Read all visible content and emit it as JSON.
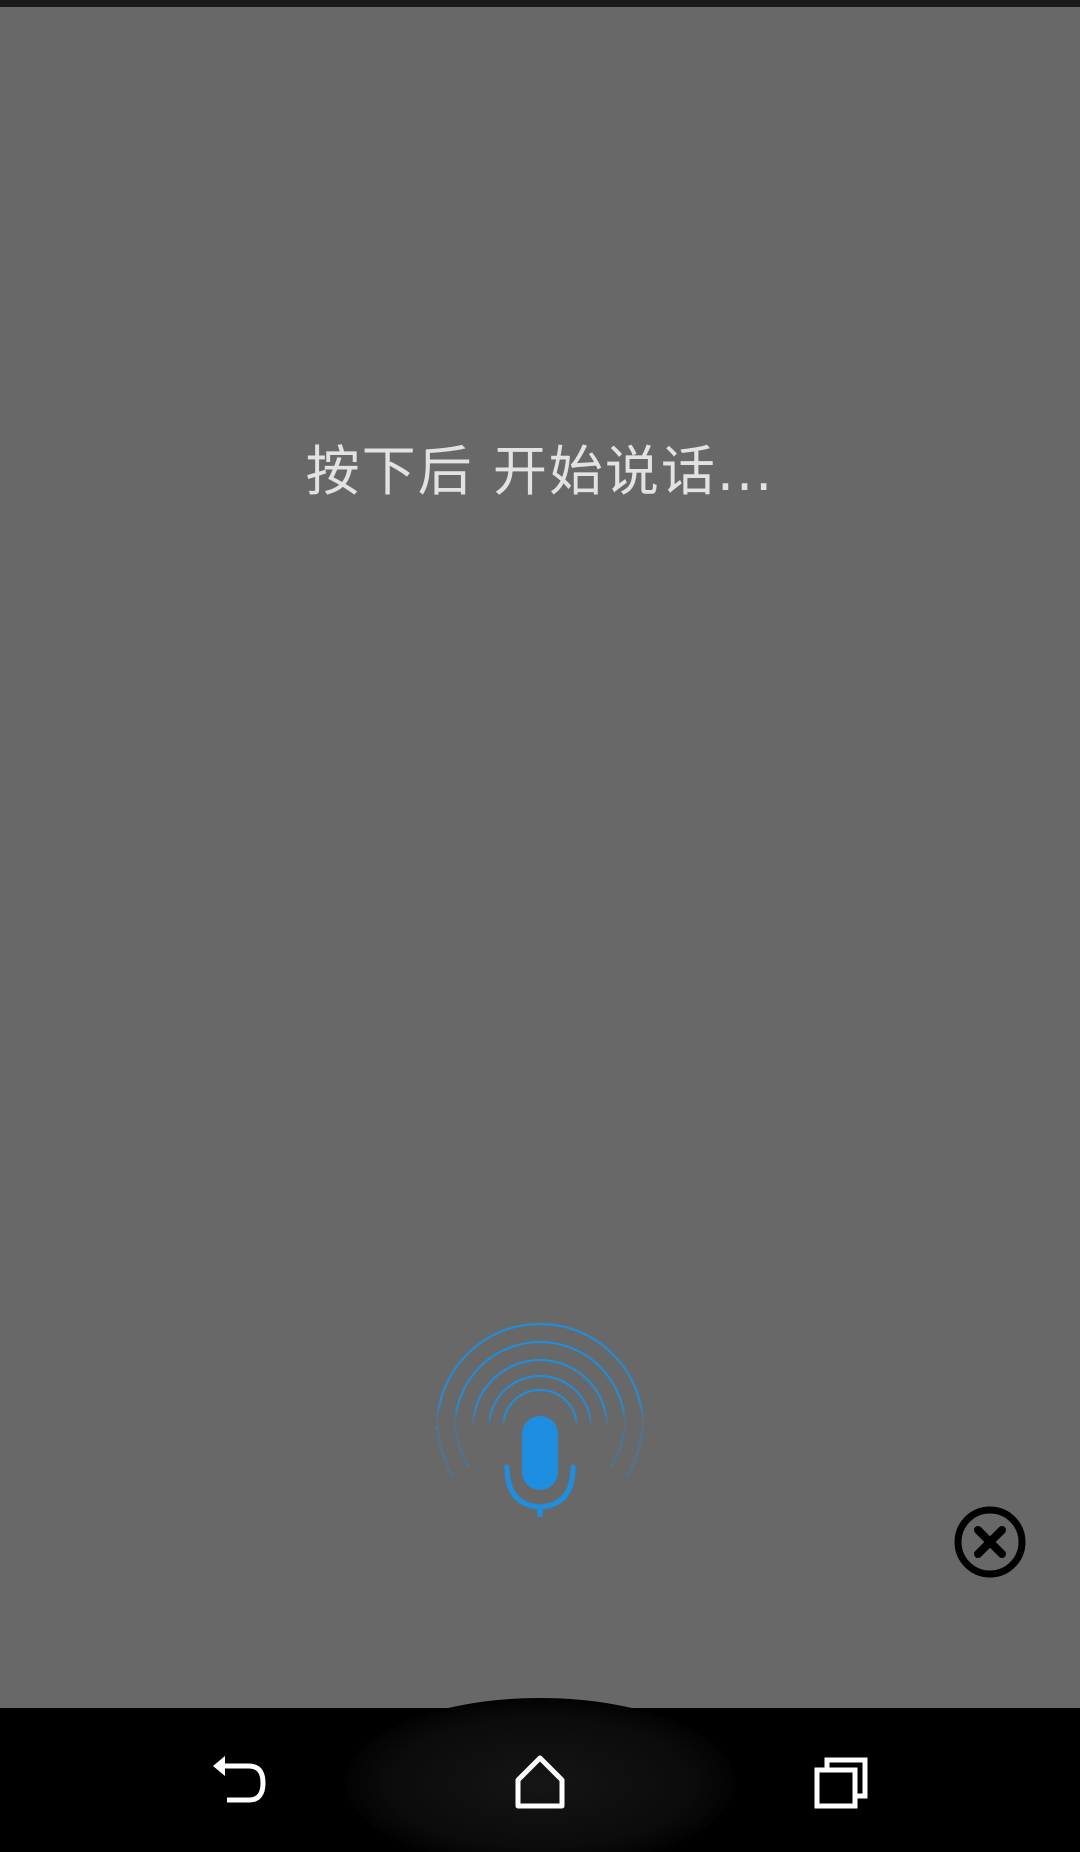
{
  "dialog": {
    "prompt_text": "按下后 开始说话..."
  },
  "icons": {
    "mic": "microphone-icon",
    "close": "close-circle-icon",
    "back": "back-icon",
    "home": "home-icon",
    "recents": "recents-icon"
  },
  "colors": {
    "overlay": "#686868",
    "accent_blue": "#1e8fe0",
    "prompt_text": "#e2e2e2",
    "navbar": "#000000"
  }
}
